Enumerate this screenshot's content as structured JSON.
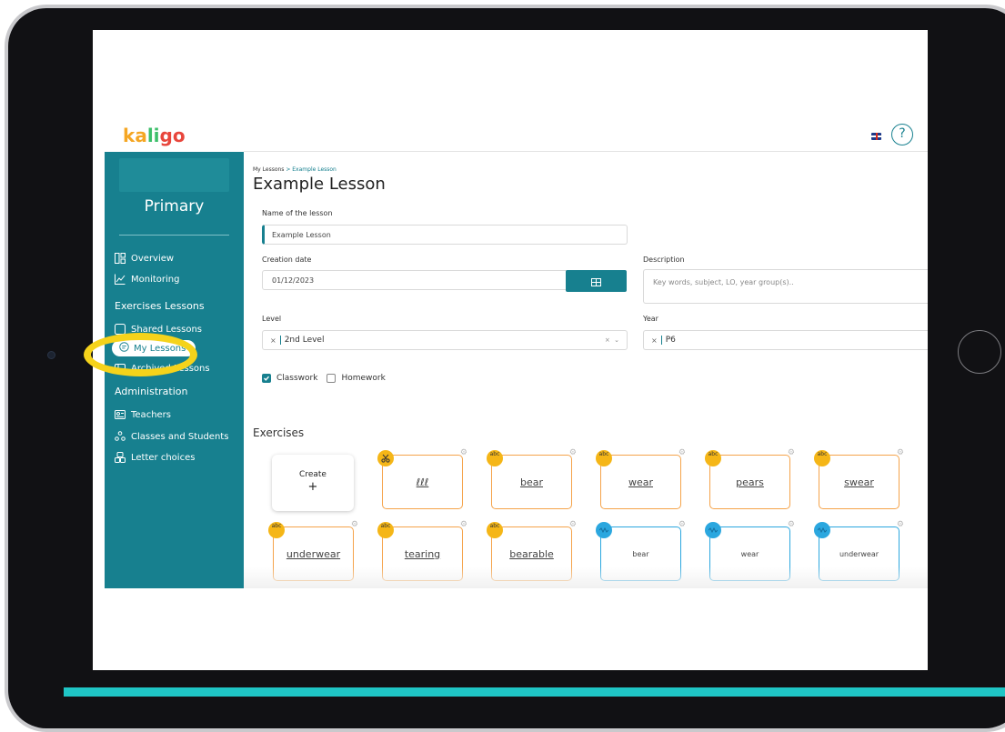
{
  "header": {
    "logo_text": "kaligo",
    "logo_letters": [
      {
        "ch": "k",
        "color": "#f5a623"
      },
      {
        "ch": "a",
        "color": "#f5a623"
      },
      {
        "ch": "l",
        "color": "#3cbf6a"
      },
      {
        "ch": "i",
        "color": "#3cbf6a"
      },
      {
        "ch": "g",
        "color": "#e8463c"
      },
      {
        "ch": "o",
        "color": "#e8463c"
      }
    ],
    "help_label": "?"
  },
  "sidebar": {
    "school_name": "Primary",
    "items": [
      {
        "label": "Overview",
        "icon": "layout-icon"
      },
      {
        "label": "Monitoring",
        "icon": "chart-line-icon"
      }
    ],
    "section_exercises": "Exercises Lessons",
    "exercise_items": [
      {
        "label": "Shared Lessons",
        "icon": "share-icon"
      },
      {
        "label": "My Lessons",
        "icon": "lesson-icon",
        "active": true
      },
      {
        "label": "Archived Lessons",
        "icon": "archive-icon"
      }
    ],
    "section_admin": "Administration",
    "admin_items": [
      {
        "label": "Teachers",
        "icon": "id-card-icon"
      },
      {
        "label": "Classes and Students",
        "icon": "users-icon"
      },
      {
        "label": "Letter choices",
        "icon": "letters-icon"
      }
    ]
  },
  "breadcrumb": {
    "root": "My Lessons",
    "sep": " > ",
    "current": "Example Lesson"
  },
  "page_title": "Example Lesson",
  "form": {
    "name_label": "Name of the lesson",
    "name_value": "Example Lesson",
    "date_label": "Creation date",
    "date_value": "01/12/2023",
    "description_label": "Description",
    "description_placeholder": "Key words, subject, LO, year group(s)..",
    "level_label": "Level",
    "level_value": "2nd Level",
    "year_label": "Year",
    "year_value": "P6",
    "classwork_label": "Classwork",
    "classwork_checked": true,
    "homework_label": "Homework",
    "homework_checked": false
  },
  "exercises": {
    "title": "Exercises",
    "create_label": "Create",
    "create_plus": "+",
    "row1": [
      {
        "label": "ℓℓℓ",
        "style": "orange",
        "badge": "scissor"
      },
      {
        "label": "bear",
        "style": "orange",
        "badge": "abc"
      },
      {
        "label": "wear",
        "style": "orange",
        "badge": "abc"
      },
      {
        "label": "pears",
        "style": "orange",
        "badge": "abc"
      },
      {
        "label": "swear",
        "style": "orange",
        "badge": "abc"
      }
    ],
    "row2": [
      {
        "label": "underwear",
        "style": "orange",
        "badge": "abc"
      },
      {
        "label": "tearing",
        "style": "orange",
        "badge": "abc"
      },
      {
        "label": "bearable",
        "style": "orange",
        "badge": "abc"
      },
      {
        "label": "bear",
        "style": "blue",
        "badge": "blue"
      },
      {
        "label": "wear",
        "style": "blue",
        "badge": "blue"
      },
      {
        "label": "underwear",
        "style": "blue",
        "badge": "blue"
      }
    ],
    "badge_abc_text": "abc"
  },
  "colors": {
    "teal": "#17808f",
    "orange_card": "#f5a34a",
    "blue_card": "#2ba7df",
    "highlight": "#f5d31b",
    "bottom_bar": "#1fc5c5"
  }
}
